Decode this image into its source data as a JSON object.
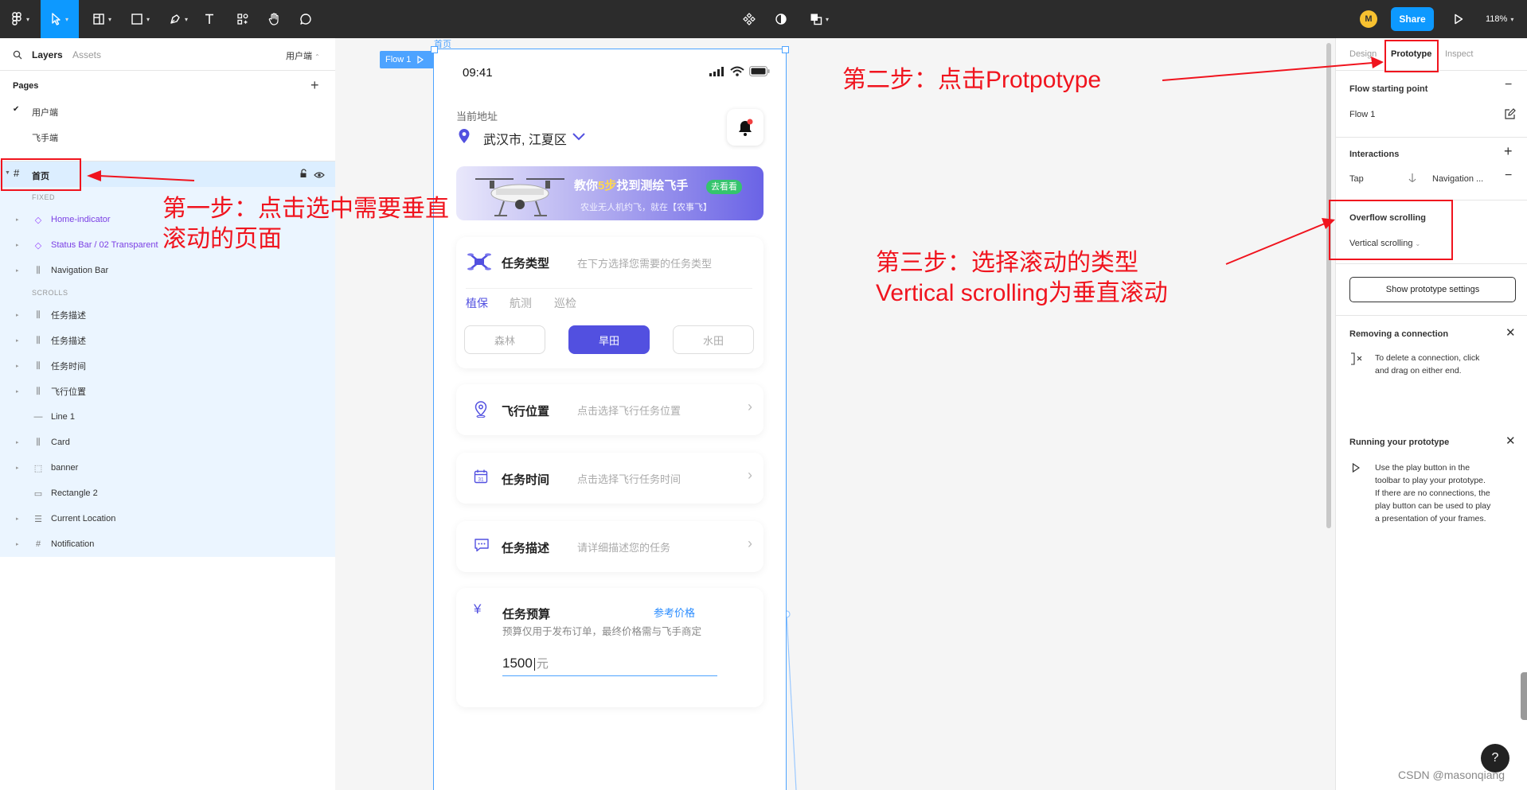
{
  "toolbar": {
    "user_initial": "M",
    "share_label": "Share",
    "zoom": "118%"
  },
  "left_panel": {
    "tabs": {
      "layers": "Layers",
      "assets": "Assets"
    },
    "page_selector": "用户端",
    "pages_title": "Pages",
    "pages": [
      {
        "label": "用户端",
        "checked": true
      },
      {
        "label": "飞手端",
        "checked": false
      }
    ],
    "selected_frame": "首页",
    "fixed_label": "FIXED",
    "scrolls_label": "SCROLLS",
    "fixed_layers": [
      {
        "name": "Home-indicator",
        "icon": "component-icon",
        "purple": true
      },
      {
        "name": "Status Bar / 02 Transparent",
        "icon": "component-icon",
        "purple": true
      },
      {
        "name": "Navigation Bar",
        "icon": "auto-layout-icon",
        "purple": false
      }
    ],
    "scroll_layers": [
      {
        "name": "任务描述",
        "icon": "auto-layout-icon"
      },
      {
        "name": "任务描述",
        "icon": "auto-layout-icon"
      },
      {
        "name": "任务时间",
        "icon": "auto-layout-icon"
      },
      {
        "name": "飞行位置",
        "icon": "auto-layout-icon"
      },
      {
        "name": "Line 1",
        "icon": "line-icon"
      },
      {
        "name": "Card",
        "icon": "auto-layout-icon"
      },
      {
        "name": "banner",
        "icon": "group-icon"
      },
      {
        "name": "Rectangle 2",
        "icon": "rectangle-icon"
      },
      {
        "name": "Current Location",
        "icon": "text-icon"
      },
      {
        "name": "Notification",
        "icon": "frame-icon"
      }
    ]
  },
  "canvas": {
    "frame_label": "首页",
    "flow_label": "Flow 1",
    "phone": {
      "time": "09:41",
      "address_label": "当前地址",
      "address": "武汉市, 江夏区",
      "banner_title_a": "教你",
      "banner_title_b": "5步",
      "banner_title_c": "找到测绘飞手",
      "banner_badge": "去看看",
      "banner_sub": "农业无人机约飞，就在【农事飞】",
      "task_type": {
        "title": "任务类型",
        "hint": "在下方选择您需要的任务类型",
        "tabs": [
          "植保",
          "航测",
          "巡检"
        ],
        "chips": [
          "森林",
          "旱田",
          "水田"
        ],
        "selected_chip": "旱田"
      },
      "rows": [
        {
          "title": "飞行位置",
          "hint": "点击选择飞行任务位置",
          "icon": "location-pin-icon"
        },
        {
          "title": "任务时间",
          "hint": "点击选择飞行任务时间",
          "icon": "calendar-icon"
        },
        {
          "title": "任务描述",
          "hint": "请详细描述您的任务",
          "icon": "message-icon"
        }
      ],
      "calendar_day": "31",
      "budget": {
        "title": "任务预算",
        "link": "参考价格",
        "note": "预算仅用于发布订单，最终价格需与飞手商定",
        "value": "1500",
        "unit": "元"
      }
    }
  },
  "annotations": {
    "step1_line1": "第一步：点击选中需要垂直",
    "step1_line2": "滚动的页面",
    "step2": "第二步：点击Protpotype",
    "step3_line1": "第三步：选择滚动的类型",
    "step3_line2": "Vertical scrolling为垂直滚动",
    "color": "#f0141e"
  },
  "right_panel": {
    "tabs": {
      "design": "Design",
      "prototype": "Prototype",
      "inspect": "Inspect"
    },
    "flow_start_title": "Flow starting point",
    "flow_name": "Flow 1",
    "interactions_title": "Interactions",
    "interaction_trigger": "Tap",
    "interaction_action": "Navigation ...",
    "overflow_title": "Overflow scrolling",
    "overflow_value": "Vertical scrolling",
    "settings_button": "Show prototype settings",
    "removing_title": "Removing a connection",
    "removing_text": [
      "To delete a connection, click",
      "and drag on either end."
    ],
    "running_title": "Running your prototype",
    "running_text": [
      "Use the play button in the",
      "toolbar to play your prototype.",
      "If there are no connections, the",
      "play button can be used to play",
      "a presentation of your frames."
    ]
  },
  "help": "?",
  "watermark": "CSDN @masonqiang",
  "colors": {
    "accent": "#0d99ff",
    "primary_purple": "#5250e0",
    "annotation_red": "#f0141e",
    "toolbar_bg": "#2c2c2c"
  }
}
